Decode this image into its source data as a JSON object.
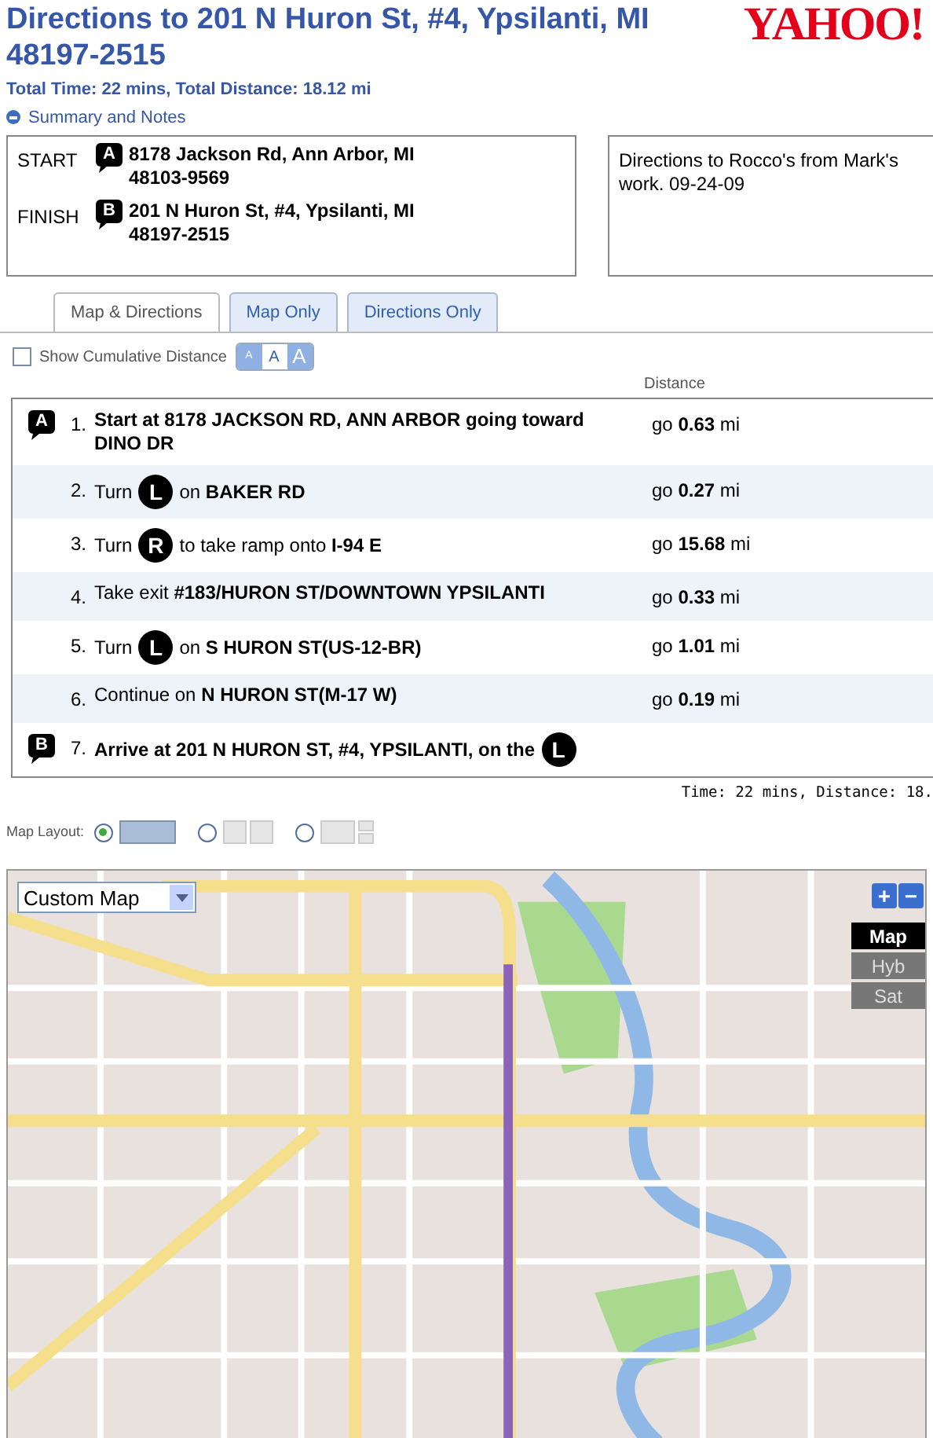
{
  "title": "Directions to 201 N Huron St, #4, Ypsilanti, MI 48197-2515",
  "logo": "YAHOO!",
  "totals": "Total Time: 22 mins, Total Distance: 18.12 mi",
  "summary_toggle": {
    "label": "Summary and Notes",
    "expanded": true
  },
  "endpoints": [
    {
      "label": "START",
      "marker": "A",
      "address": "8178 Jackson Rd, Ann Arbor, MI 48103-9569"
    },
    {
      "label": "FINISH",
      "marker": "B",
      "address": "201 N Huron St, #4, Ypsilanti, MI 48197-2515"
    }
  ],
  "notes": "Directions to Rocco's from Mark's work. 09-24-09",
  "tabs": [
    {
      "label": "Map & Directions",
      "selected": true
    },
    {
      "label": "Map Only",
      "selected": false
    },
    {
      "label": "Directions Only",
      "selected": false
    }
  ],
  "cumulative": {
    "label": "Show Cumulative Distance",
    "checked": false
  },
  "font_sizes": [
    {
      "label": "A",
      "selected": false
    },
    {
      "label": "A",
      "selected": true
    },
    {
      "label": "A",
      "selected": false
    }
  ],
  "distance_heading": "Distance",
  "steps": [
    {
      "marker": "A",
      "number": "1.",
      "bold": true,
      "parts": [
        {
          "kind": "text",
          "text": "Start at 8178 JACKSON RD, ANN ARBOR going toward DINO DR"
        }
      ],
      "distance": "go **0.63** mi"
    },
    {
      "number": "2.",
      "bold": false,
      "parts": [
        {
          "kind": "text",
          "text": "Turn"
        },
        {
          "kind": "turn",
          "text": "L"
        },
        {
          "kind": "text",
          "text": "on **BAKER RD**"
        }
      ],
      "distance": "go **0.27** mi"
    },
    {
      "number": "3.",
      "bold": false,
      "parts": [
        {
          "kind": "text",
          "text": "Turn"
        },
        {
          "kind": "turn",
          "text": "R"
        },
        {
          "kind": "text",
          "text": "to take ramp onto **I-94 E**"
        }
      ],
      "distance": "go **15.68** mi"
    },
    {
      "number": "4.",
      "bold": false,
      "parts": [
        {
          "kind": "text",
          "text": "Take exit **#183/HURON ST/DOWNTOWN YPSILANTI**"
        }
      ],
      "distance": "go **0.33** mi"
    },
    {
      "number": "5.",
      "bold": false,
      "parts": [
        {
          "kind": "text",
          "text": "Turn"
        },
        {
          "kind": "turn",
          "text": "L"
        },
        {
          "kind": "text",
          "text": "on **S HURON ST(US-12-BR)**"
        }
      ],
      "distance": "go **1.01** mi"
    },
    {
      "number": "6.",
      "bold": false,
      "parts": [
        {
          "kind": "text",
          "text": "Continue on **N HURON ST(M-17 W)**"
        }
      ],
      "distance": "go **0.19** mi"
    },
    {
      "marker": "B",
      "number": "7.",
      "bold": true,
      "parts": [
        {
          "kind": "text",
          "text": "Arrive at 201 N HURON ST, #4, YPSILANTI, on the"
        },
        {
          "kind": "turn",
          "text": "L"
        }
      ]
    }
  ],
  "trip_summary": "Time: 22 mins, Distance: 18.",
  "map_layout": {
    "label": "Map Layout:",
    "options": [
      {
        "kind": "single",
        "selected": true
      },
      {
        "kind": "split",
        "selected": false
      },
      {
        "kind": "grid",
        "selected": false
      }
    ]
  },
  "map": {
    "style_select": "Custom Map",
    "zoom_in": "+",
    "zoom_out": "−",
    "types": [
      {
        "label": "Map",
        "selected": true
      },
      {
        "label": "Hyb",
        "selected": false
      },
      {
        "label": "Sat",
        "selected": false
      }
    ]
  }
}
